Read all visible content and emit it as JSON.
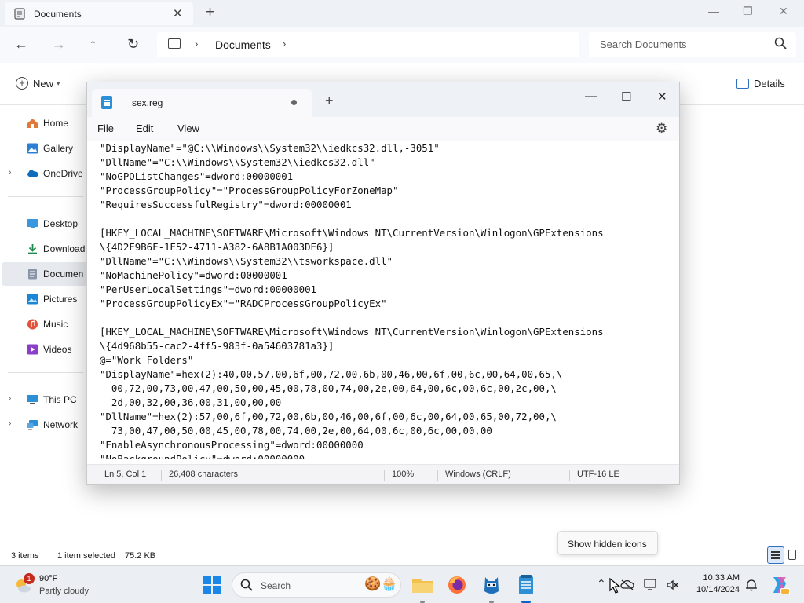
{
  "explorer": {
    "tab_title": "Documents",
    "breadcrumb": "Documents",
    "search_placeholder": "Search Documents",
    "toolbar": {
      "new_label": "New",
      "details_label": "Details"
    },
    "nav_items": [
      {
        "label": "Home",
        "icon": "home-icon"
      },
      {
        "label": "Gallery",
        "icon": "gallery-icon"
      },
      {
        "label": "OneDrive",
        "icon": "onedrive-icon"
      },
      {
        "label": "Desktop",
        "icon": "desktop-folder-icon"
      },
      {
        "label": "Download",
        "icon": "downloads-folder-icon"
      },
      {
        "label": "Documen",
        "icon": "documents-folder-icon"
      },
      {
        "label": "Pictures",
        "icon": "pictures-folder-icon"
      },
      {
        "label": "Music",
        "icon": "music-folder-icon"
      },
      {
        "label": "Videos",
        "icon": "videos-folder-icon"
      },
      {
        "label": "This PC",
        "icon": "this-pc-icon"
      },
      {
        "label": "Network",
        "icon": "network-icon"
      }
    ],
    "status": {
      "items": "3 items",
      "selected": "1 item selected",
      "size": "75.2 KB"
    }
  },
  "notepad": {
    "tab_title": "sex.reg",
    "menu": [
      "File",
      "Edit",
      "View"
    ],
    "content": "\"DisplayName\"=\"@C:\\\\Windows\\\\System32\\\\iedkcs32.dll,-3051\"\n\"DllName\"=\"C:\\\\Windows\\\\System32\\\\iedkcs32.dll\"\n\"NoGPOListChanges\"=dword:00000001\n\"ProcessGroupPolicy\"=\"ProcessGroupPolicyForZoneMap\"\n\"RequiresSuccessfulRegistry\"=dword:00000001\n\n[HKEY_LOCAL_MACHINE\\SOFTWARE\\Microsoft\\Windows NT\\CurrentVersion\\Winlogon\\GPExtensions\n\\{4D2F9B6F-1E52-4711-A382-6A8B1A003DE6}]\n\"DllName\"=\"C:\\\\Windows\\\\System32\\\\tsworkspace.dll\"\n\"NoMachinePolicy\"=dword:00000001\n\"PerUserLocalSettings\"=dword:00000001\n\"ProcessGroupPolicyEx\"=\"RADCProcessGroupPolicyEx\"\n\n[HKEY_LOCAL_MACHINE\\SOFTWARE\\Microsoft\\Windows NT\\CurrentVersion\\Winlogon\\GPExtensions\n\\{4d968b55-cac2-4ff5-983f-0a54603781a3}]\n@=\"Work Folders\"\n\"DisplayName\"=hex(2):40,00,57,00,6f,00,72,00,6b,00,46,00,6f,00,6c,00,64,00,65,\\\n  00,72,00,73,00,47,00,50,00,45,00,78,00,74,00,2e,00,64,00,6c,00,6c,00,2c,00,\\\n  2d,00,32,00,36,00,31,00,00,00\n\"DllName\"=hex(2):57,00,6f,00,72,00,6b,00,46,00,6f,00,6c,00,64,00,65,00,72,00,\\\n  73,00,47,00,50,00,45,00,78,00,74,00,2e,00,64,00,6c,00,6c,00,00,00\n\"EnableAsynchronousProcessing\"=dword:00000000\n\"NoBackgroundPolicy\"=dword:00000000",
    "status": {
      "position": "Ln 5, Col 1",
      "characters": "26,408 characters",
      "zoom": "100%",
      "line_endings": "Windows (CRLF)",
      "encoding": "UTF-16 LE"
    }
  },
  "tooltip": "Show hidden icons",
  "taskbar": {
    "weather": {
      "temp": "90°F",
      "condition": "Partly cloudy",
      "badge": "1"
    },
    "search_label": "Search",
    "clock": {
      "time": "10:33 AM",
      "date": "10/14/2024"
    }
  },
  "colors": {
    "accent": "#0a64c8",
    "folder_yellow": "#f2c14e",
    "notepad_blue": "#2d8fd5"
  }
}
